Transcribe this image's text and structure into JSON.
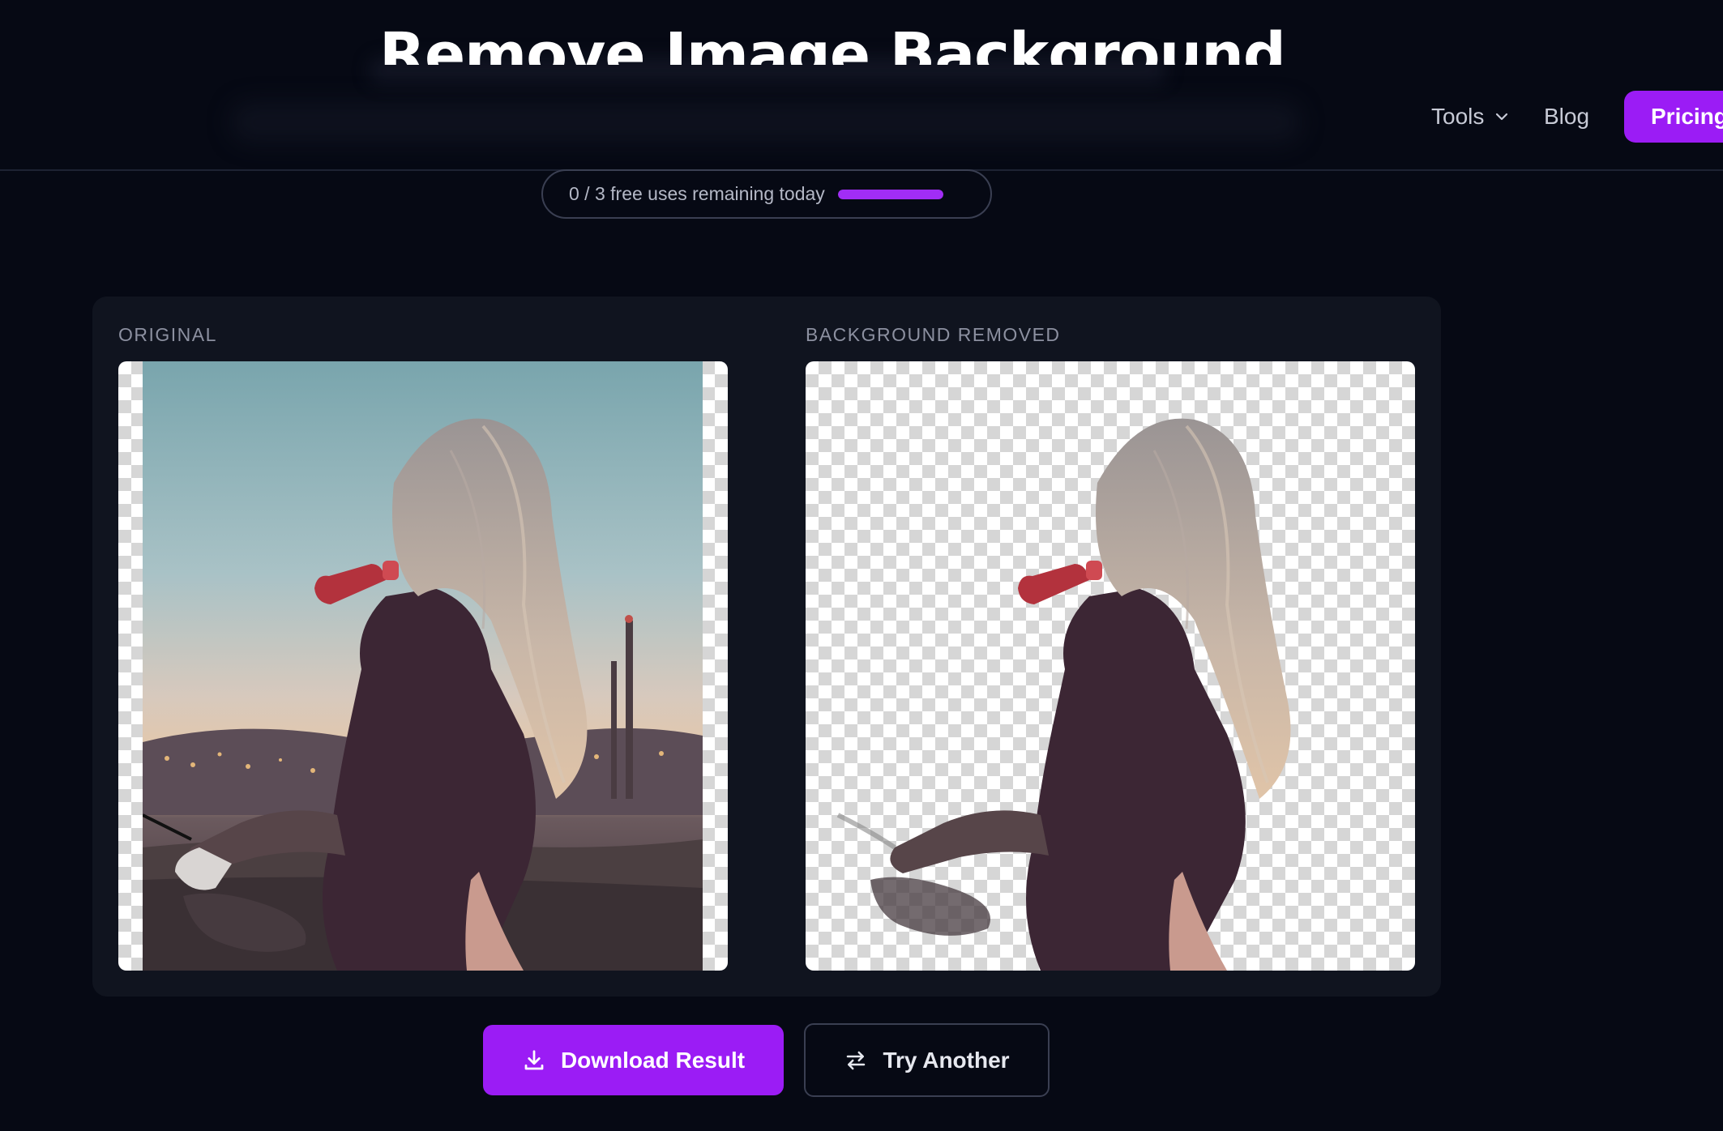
{
  "header": {
    "title": "Remove Image Background"
  },
  "nav": {
    "tools_label": "Tools",
    "blog_label": "Blog",
    "pricing_label": "Pricing"
  },
  "usage": {
    "text": "0 / 3 free uses remaining today",
    "bar_fill_fraction": 1.0
  },
  "compare": {
    "original_label": "ORIGINAL",
    "result_label": "BACKGROUND REMOVED"
  },
  "actions": {
    "download_label": "Download Result",
    "try_another_label": "Try Another"
  },
  "colors": {
    "background": "#060914",
    "panel": "#10141f",
    "accent": "#9b1cf5",
    "usage_bar": "#a12df5"
  },
  "icons": {
    "tools_dropdown": "chevron-down-icon",
    "download": "download-icon",
    "try_another": "swap-arrows-icon"
  }
}
